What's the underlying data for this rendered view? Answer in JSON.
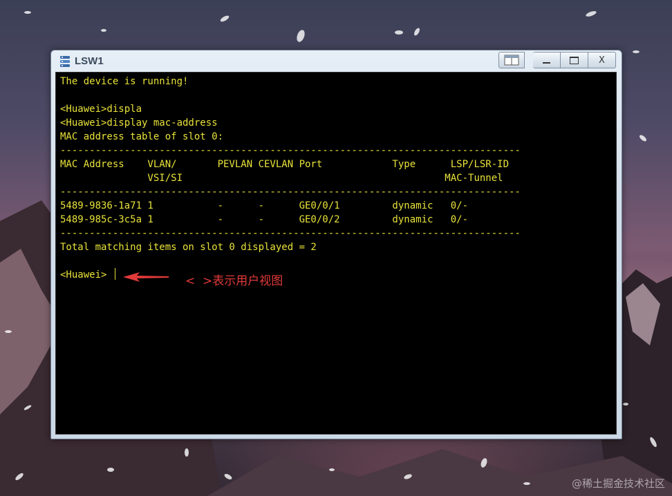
{
  "window": {
    "title": "LSW1",
    "close_label": "X"
  },
  "terminal": {
    "lines": [
      "The device is running!",
      "",
      "<Huawei>displa",
      "<Huawei>display mac-address",
      "MAC address table of slot 0:",
      "-------------------------------------------------------------------------------",
      "MAC Address    VLAN/       PEVLAN CEVLAN Port            Type      LSP/LSR-ID",
      "               VSI/SI                                             MAC-Tunnel",
      "-------------------------------------------------------------------------------",
      "5489-9836-1a71 1           -      -      GE0/0/1         dynamic   0/-",
      "5489-985c-3c5a 1           -      -      GE0/0/2         dynamic   0/-",
      "-------------------------------------------------------------------------------",
      "Total matching items on slot 0 displayed = 2",
      "",
      "<Huawei>"
    ],
    "text_color": "#e8e23a",
    "background": "#000000"
  },
  "annotation": {
    "text": "<  >表示用户视图",
    "color": "#e23a3a"
  },
  "watermark": "@稀土掘金技术社区"
}
